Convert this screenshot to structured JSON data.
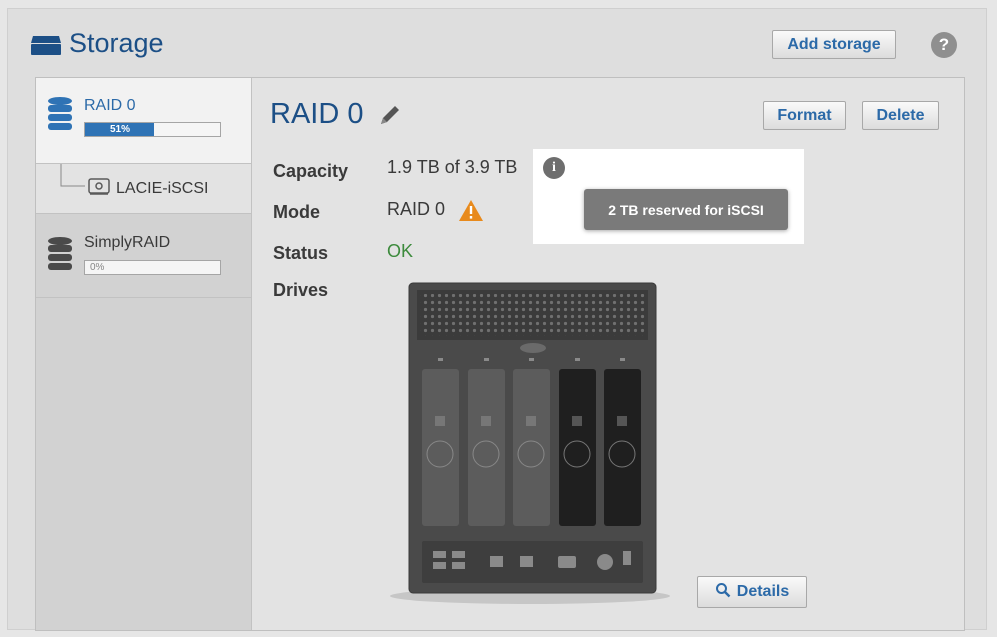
{
  "header": {
    "title": "Storage",
    "add_storage_label": "Add storage",
    "help_icon_text": "?"
  },
  "sidebar": {
    "items": [
      {
        "label": "RAID 0",
        "usage_text": "51%",
        "usage_percent": 51,
        "icon": "database-icon"
      },
      {
        "label": "LACIE-iSCSI",
        "icon": "hard-drive-icon"
      },
      {
        "label": "SimplyRAID",
        "usage_text": "0%",
        "usage_percent": 0,
        "icon": "database-icon"
      }
    ]
  },
  "main": {
    "title": "RAID 0",
    "format_label": "Format",
    "delete_label": "Delete",
    "properties": {
      "capacity_label": "Capacity",
      "capacity_value": "1.9 TB of 3.9 TB",
      "mode_label": "Mode",
      "mode_value": "RAID 0",
      "status_label": "Status",
      "status_value": "OK",
      "drives_label": "Drives"
    },
    "tooltip_text": "2 TB reserved for iSCSI",
    "info_icon_text": "i",
    "details_label": "Details"
  },
  "colors": {
    "accent": "#1c4f86",
    "link_blue": "#2c6aa8",
    "progress_fill": "#2f73b5",
    "status_ok": "#3c8a3c",
    "warning": "#e88a1c"
  },
  "drives": {
    "bays": [
      {
        "state": "empty"
      },
      {
        "state": "empty"
      },
      {
        "state": "empty"
      },
      {
        "state": "active"
      },
      {
        "state": "active"
      }
    ]
  }
}
